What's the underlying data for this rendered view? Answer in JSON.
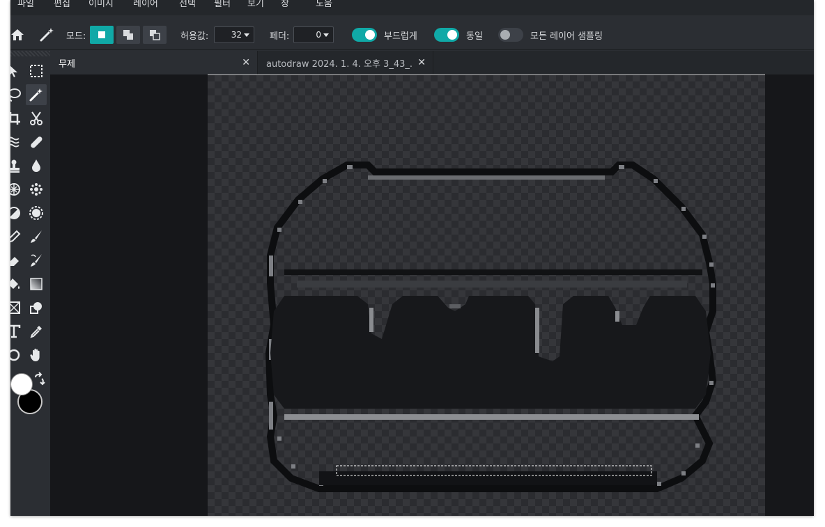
{
  "menu": {
    "items": [
      "파일",
      "편집",
      "이미지",
      "레이어",
      "선택",
      "필터",
      "보기",
      "창",
      "도움"
    ]
  },
  "options": {
    "mode_label": "모드:",
    "tolerance_label": "허용값:",
    "tolerance_value": "32",
    "feather_label": "페더:",
    "feather_value": "0",
    "smooth_label": "부드럽게",
    "smooth_on": true,
    "contiguous_label": "동일",
    "contiguous_on": true,
    "sample_all_label": "모든 레이어 샘플링",
    "sample_all_on": false
  },
  "tabs": [
    {
      "title": "무제",
      "active": true
    },
    {
      "title": "autodraw 2024. 1. 4. 오후 3_43_...",
      "active": false
    }
  ],
  "colors": {
    "accent": "#10a9a7",
    "foreground": "#ffffff",
    "background": "#000000"
  },
  "tools": [
    "move-icon",
    "marquee-icon",
    "lasso-icon",
    "magic-wand-icon",
    "crop-icon",
    "scissors-icon",
    "liquify-icon",
    "healing-bandage-icon",
    "clone-stamp-icon",
    "blur-drop-icon",
    "sponge-icon",
    "spot-heal-icon",
    "dodge-icon",
    "sharpen-icon",
    "pencil-icon",
    "brush-icon",
    "eraser-icon",
    "color-replace-icon",
    "paint-bucket-icon",
    "gradient-icon",
    "shape-icon",
    "clip-icon",
    "type-icon",
    "eyedropper-icon",
    "ellipse-icon",
    "hand-icon"
  ]
}
